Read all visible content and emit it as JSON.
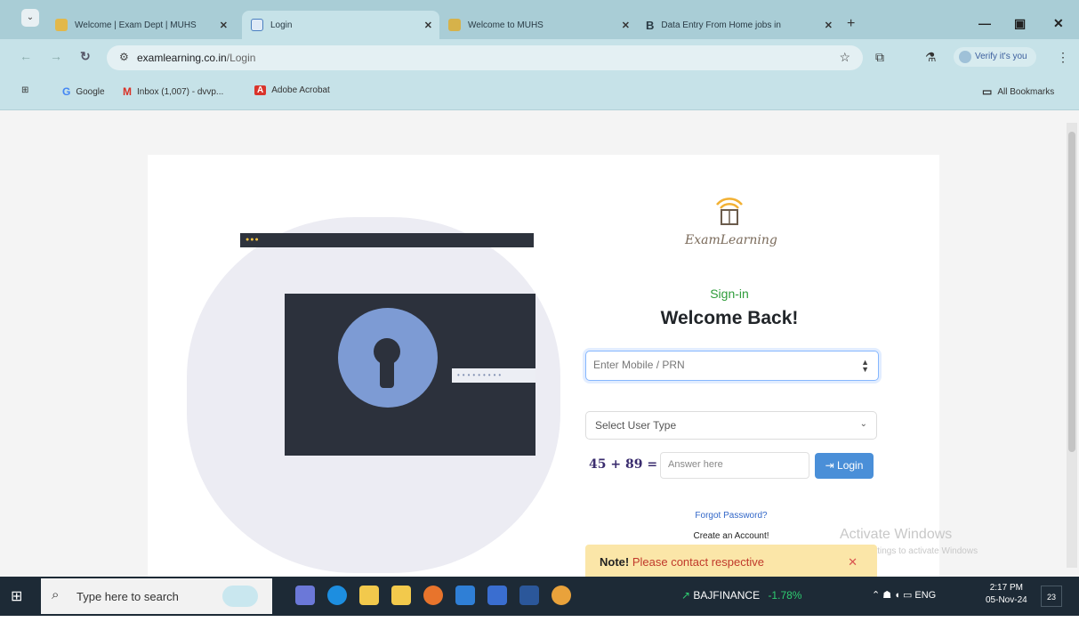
{
  "browser": {
    "tabs": [
      {
        "label": "Welcome | Exam Dept | MUHS",
        "active": false
      },
      {
        "label": "Login",
        "active": true
      },
      {
        "label": "Welcome to MUHS",
        "active": false
      },
      {
        "label": "Data Entry From Home jobs in",
        "active": false
      }
    ],
    "url_domain": "examlearning.co.in",
    "url_path": "/Login",
    "profile_label": "Verify it's you",
    "bookmarks": [
      {
        "label": "Google",
        "icon": "google-icon"
      },
      {
        "label": "Inbox (1,007) - dvvp...",
        "icon": "gmail-icon"
      },
      {
        "label": "Adobe Acrobat",
        "icon": "acrobat-icon"
      }
    ],
    "all_bookmarks_label": "All Bookmarks"
  },
  "login": {
    "brand": "ExamLearning",
    "signin_label": "Sign-in",
    "heading": "Welcome Back!",
    "mobile_placeholder": "Enter Mobile / PRN",
    "user_type_selected": "Select User Type",
    "captcha": "45 + 89 =",
    "answer_placeholder": "Answer here",
    "login_button": "Login",
    "forgot_password": "Forgot Password?",
    "create_account": "Create an Account!",
    "note_title": "Note!",
    "note_text": "Please contact respective",
    "illustration_password_mask": "•••••••••"
  },
  "watermark": {
    "title": "Activate Windows",
    "subtitle": "Go to Settings to activate Windows"
  },
  "taskbar": {
    "search_placeholder": "Type here to search",
    "ticker_name": "BAJFINANCE",
    "ticker_change": "-1.78%",
    "language": "ENG",
    "time": "2:17 PM",
    "date": "05-Nov-24",
    "notification_count": "23"
  },
  "colors": {
    "accent_green": "#2e9c3a",
    "button_blue": "#4a8fd8",
    "note_bg": "#fbe6a8",
    "tab_bar": "#a9cdd6"
  }
}
